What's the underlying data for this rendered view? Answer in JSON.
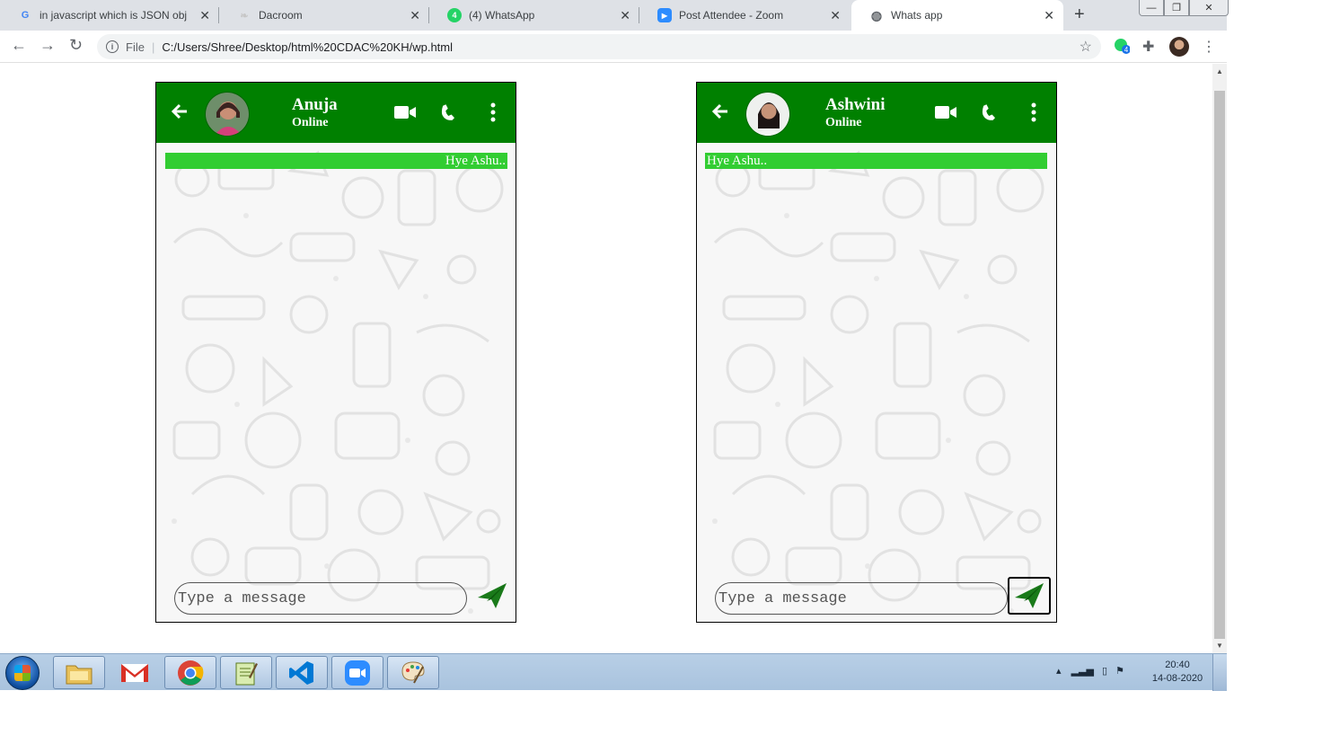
{
  "browser": {
    "tabs": [
      {
        "title": "in javascript which is JSON obj",
        "favicon": "google-icon",
        "active": false
      },
      {
        "title": "Dacroom",
        "favicon": "leaf-icon",
        "active": false
      },
      {
        "title": "(4) WhatsApp",
        "favicon": "whatsapp-icon",
        "active": false
      },
      {
        "title": "Post Attendee - Zoom",
        "favicon": "zoom-icon",
        "active": false
      },
      {
        "title": "Whats app",
        "favicon": "globe-icon",
        "active": true
      }
    ],
    "address": {
      "scheme_label": "File",
      "url": "C:/Users/Shree/Desktop/html%20CDAC%20KH/wp.html"
    },
    "extension_badge": "4"
  },
  "chats": [
    {
      "contact_name": "Anuja",
      "status": "Online",
      "message": "Hye Ashu..",
      "message_side": "right",
      "input_placeholder": "Type a message"
    },
    {
      "contact_name": "Ashwini",
      "status": "Online",
      "message": "Hye Ashu..",
      "message_side": "left",
      "input_placeholder": "Type a message"
    }
  ],
  "taskbar": {
    "apps": [
      "file-explorer",
      "gmail",
      "chrome",
      "notepad-plus-plus",
      "vscode",
      "zoom",
      "paint"
    ],
    "clock": {
      "time": "20:40",
      "date": "14-08-2020"
    }
  },
  "colors": {
    "header_green": "#008000",
    "bubble_green": "#32cd32",
    "send_green": "#1a7a1a"
  }
}
